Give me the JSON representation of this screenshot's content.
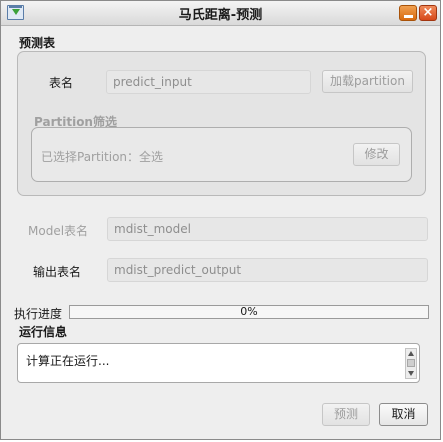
{
  "window": {
    "title": "马氏距离-预测",
    "minimize_icon": "minimize-icon",
    "close_icon": "close-icon",
    "close_glyph": "×"
  },
  "predict_table": {
    "section_title": "预测表",
    "table_label": "表名",
    "table_value": "predict_input",
    "load_partition_button": "加载partition",
    "partition_filter": {
      "title": "Partition筛选",
      "selected_text": "已选择Partition：全选",
      "modify_button": "修改"
    }
  },
  "model": {
    "label": "Model表名",
    "value": "mdist_model"
  },
  "output": {
    "label": "输出表名",
    "value": "mdist_predict_output"
  },
  "progress": {
    "label": "执行进度",
    "value": 0,
    "text": "0%"
  },
  "run_info": {
    "section_title": "运行信息",
    "log_text": "计算正在运行..."
  },
  "footer": {
    "predict_button": "预测",
    "cancel_button": "取消"
  }
}
